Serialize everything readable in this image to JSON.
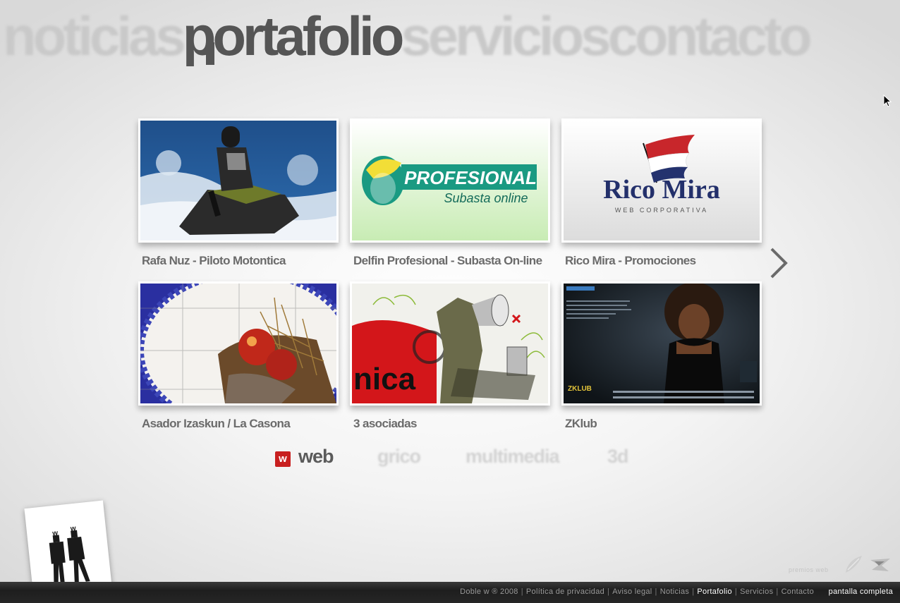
{
  "nav": {
    "items": [
      {
        "label": "noticias",
        "active": false
      },
      {
        "label": "portafolio",
        "active": true
      },
      {
        "label": "servicios",
        "active": false
      },
      {
        "label": "contacto",
        "active": false
      }
    ]
  },
  "portfolio": {
    "items": [
      {
        "caption": "Rafa Nuz - Piloto Motontica",
        "thumb_kind": "jetski"
      },
      {
        "caption": "Delfin Profesional - Subasta On-line",
        "thumb_kind": "delfin",
        "logo_title": "PROFESIONAL",
        "logo_sub": "Subasta online"
      },
      {
        "caption": "Rico Mira - Promociones",
        "thumb_kind": "ricomira",
        "logo_title": "Rico Mira",
        "logo_sub": "WEB CORPORATIVA"
      },
      {
        "caption": "Asador Izaskun / La Casona",
        "thumb_kind": "food"
      },
      {
        "caption": "3 asociadas",
        "thumb_kind": "collage",
        "thumb_text": "nica"
      },
      {
        "caption": "ZKlub",
        "thumb_kind": "zklub",
        "thumb_text": "ZKLUB"
      }
    ],
    "next_icon": "chevron-right-icon"
  },
  "categories": {
    "badge": "w",
    "items": [
      {
        "label": "web",
        "active": true
      },
      {
        "label": "grico",
        "active": false
      },
      {
        "label": "multimedia",
        "active": false
      },
      {
        "label": "3d",
        "active": false
      }
    ]
  },
  "awards": {
    "label": "premios web"
  },
  "footer": {
    "copyright": "Doble w ® 2008",
    "links": [
      {
        "label": "Política de privacidad",
        "active": false
      },
      {
        "label": "Aviso legal",
        "active": false
      },
      {
        "label": "Noticias",
        "active": false
      },
      {
        "label": "Portafolio",
        "active": true
      },
      {
        "label": "Servicios",
        "active": false
      },
      {
        "label": "Contacto",
        "active": false
      }
    ],
    "fullscreen": "pantalla completa"
  },
  "colors": {
    "accent": "#c81f1f",
    "text_dark": "#555555",
    "text_faded": "#c9c9c9"
  }
}
